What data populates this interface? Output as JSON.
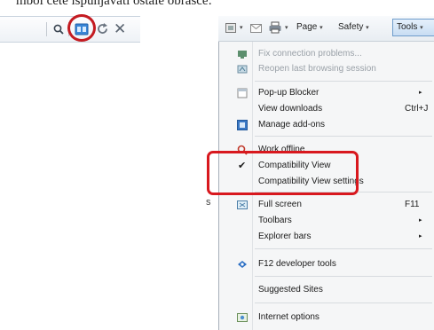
{
  "caption": "mbol ćete ispunjavati ostale obrasce:",
  "address_bar": {
    "icons": [
      "search-icon",
      "compatibility-view-icon",
      "refresh-icon",
      "close-icon"
    ],
    "close_glyph": "✕"
  },
  "toolbar": {
    "page_label": "Page",
    "safety_label": "Safety",
    "tools_label": "Tools",
    "caret": "▾"
  },
  "menu": {
    "items": [
      {
        "label": "Fix connection problems...",
        "shortcut": "",
        "submenu": false,
        "disabled": true,
        "icon": "network-diagnose-icon"
      },
      {
        "label": "Reopen last browsing session",
        "shortcut": "",
        "submenu": false,
        "disabled": true,
        "icon": "reopen-session-icon"
      },
      {
        "label": "Pop-up Blocker",
        "shortcut": "",
        "submenu": true,
        "disabled": false,
        "icon": "popup-blocker-icon"
      },
      {
        "label": "View downloads",
        "shortcut": "Ctrl+J",
        "submenu": false,
        "disabled": false,
        "icon": ""
      },
      {
        "label": "Manage add-ons",
        "shortcut": "",
        "submenu": false,
        "disabled": false,
        "icon": "manage-addons-icon"
      },
      {
        "label": "Work offline",
        "shortcut": "",
        "submenu": false,
        "disabled": false,
        "icon": "work-offline-icon"
      },
      {
        "label": "Compatibility View",
        "shortcut": "",
        "submenu": false,
        "disabled": false,
        "icon": "checkmark-icon",
        "checked": true
      },
      {
        "label": "Compatibility View settings",
        "shortcut": "",
        "submenu": false,
        "disabled": false,
        "icon": ""
      },
      {
        "label": "Full screen",
        "shortcut": "F11",
        "submenu": false,
        "disabled": false,
        "icon": "full-screen-icon"
      },
      {
        "label": "Toolbars",
        "shortcut": "",
        "submenu": true,
        "disabled": false,
        "icon": ""
      },
      {
        "label": "Explorer bars",
        "shortcut": "",
        "submenu": true,
        "disabled": false,
        "icon": ""
      },
      {
        "label": "F12 developer tools",
        "shortcut": "",
        "submenu": false,
        "disabled": false,
        "icon": "developer-tools-icon"
      },
      {
        "label": "Suggested Sites",
        "shortcut": "",
        "submenu": false,
        "disabled": false,
        "icon": ""
      },
      {
        "label": "Internet options",
        "shortcut": "",
        "submenu": false,
        "disabled": false,
        "icon": "internet-options-icon"
      }
    ],
    "submenu_glyph": "▸",
    "check_glyph": "✔"
  },
  "colors": {
    "highlight_red": "#d8181e",
    "menu_bg": "#f5f6f7",
    "icon_blue": "#2b6fc4"
  }
}
